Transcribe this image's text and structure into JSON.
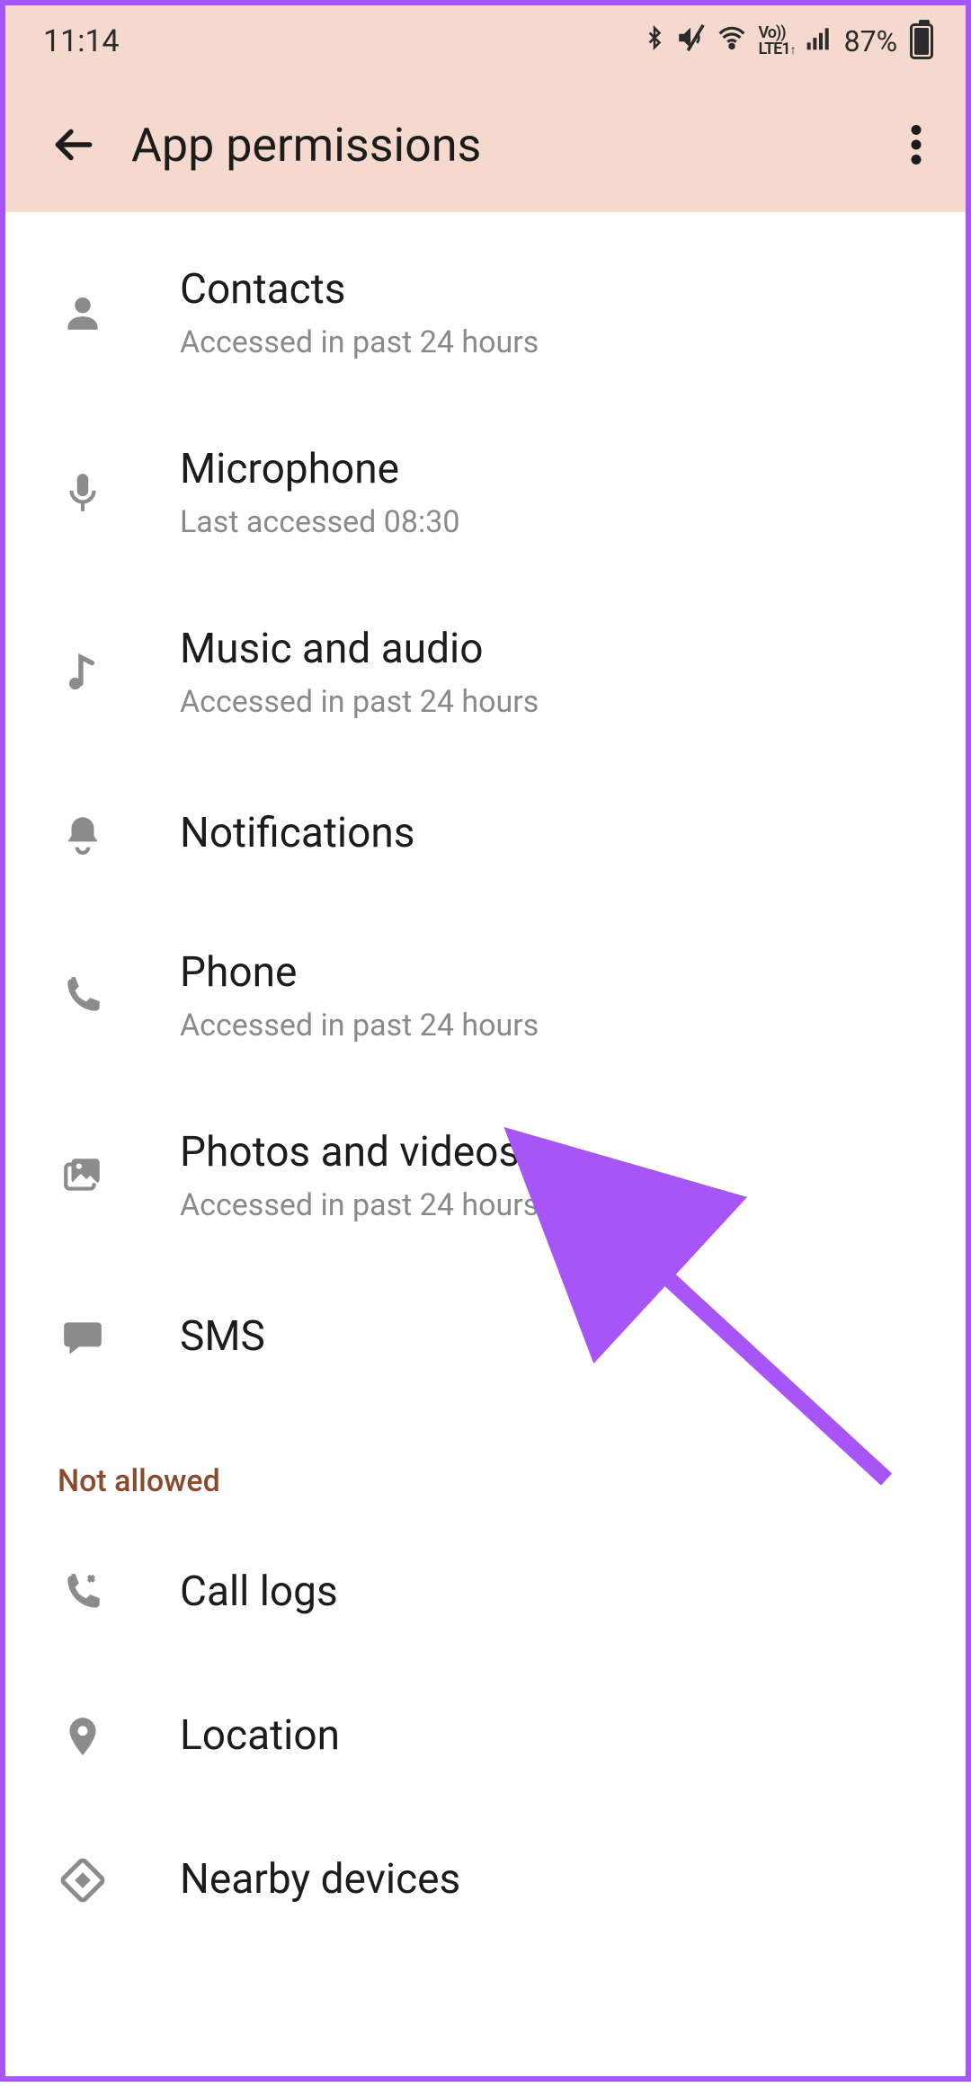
{
  "status": {
    "time": "11:14",
    "battery_pct": "87%",
    "battery_fill_pct": 87,
    "volte": "Vo)) LTE1"
  },
  "header": {
    "title": "App permissions"
  },
  "allowed": [
    {
      "icon": "person",
      "title": "Contacts",
      "sub": "Accessed in past 24 hours"
    },
    {
      "icon": "mic",
      "title": "Microphone",
      "sub": "Last accessed 08:30"
    },
    {
      "icon": "music",
      "title": "Music and audio",
      "sub": "Accessed in past 24 hours"
    },
    {
      "icon": "bell",
      "title": "Notifications",
      "sub": ""
    },
    {
      "icon": "phone",
      "title": "Phone",
      "sub": "Accessed in past 24 hours"
    },
    {
      "icon": "gallery",
      "title": "Photos and videos",
      "sub": "Accessed in past 24 hours"
    },
    {
      "icon": "sms",
      "title": "SMS",
      "sub": ""
    }
  ],
  "section_not_allowed": "Not allowed",
  "not_allowed": [
    {
      "icon": "calllog",
      "title": "Call logs",
      "sub": ""
    },
    {
      "icon": "location",
      "title": "Location",
      "sub": ""
    },
    {
      "icon": "nearby",
      "title": "Nearby devices",
      "sub": ""
    }
  ],
  "annotation": {
    "color": "#a855f7"
  }
}
